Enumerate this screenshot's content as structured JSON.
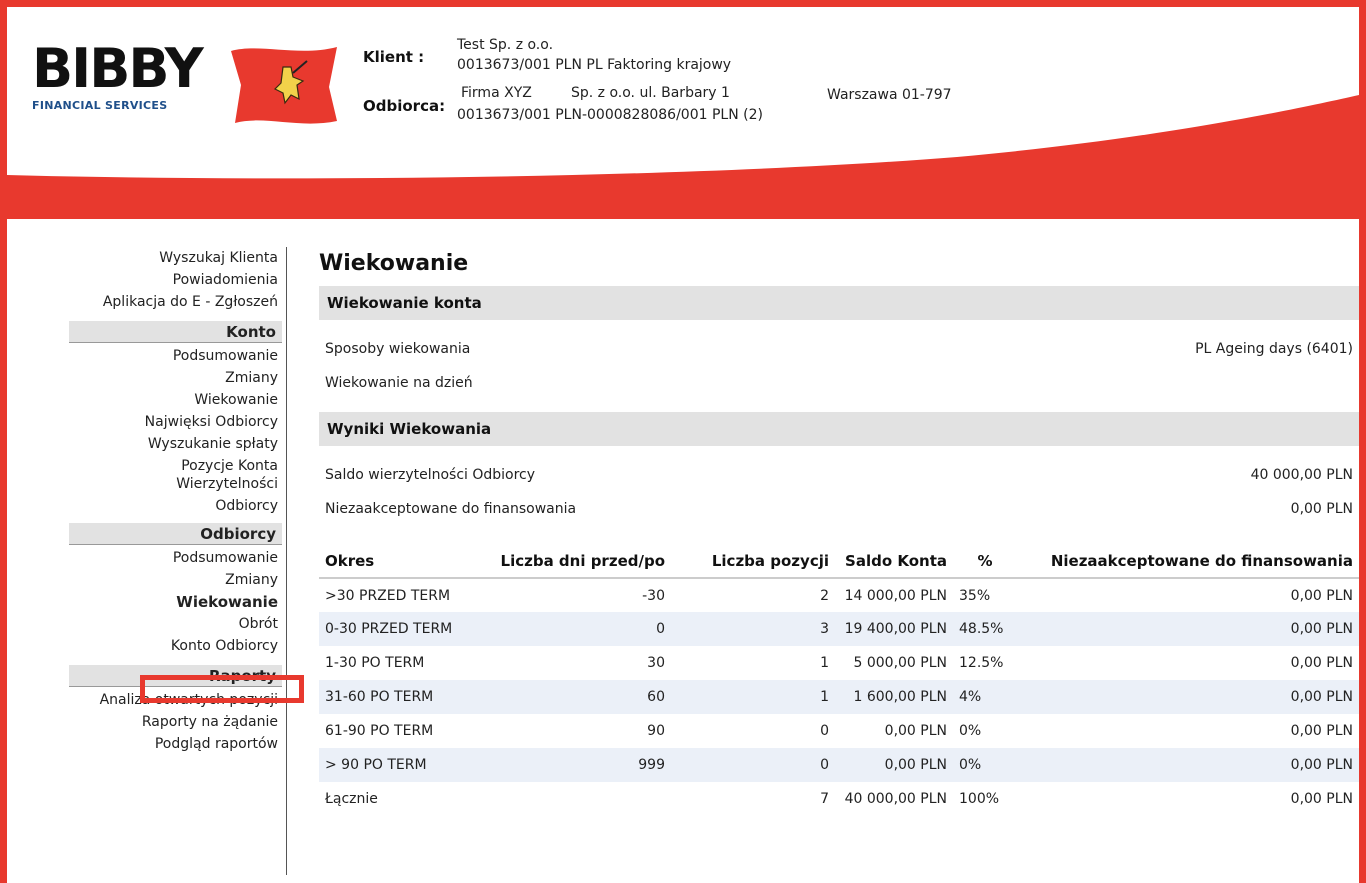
{
  "colors": {
    "brand_red": "#e8392e",
    "section_bar": "#e2e2e2",
    "row_alt": "#ebf0f8",
    "logo_blue": "#1f4f8a"
  },
  "header": {
    "logo_word": "BIBBY",
    "logo_sub": "FINANCIAL SERVICES",
    "flag_icon": "bibby-flag-icon",
    "client_label": "Klient :",
    "client_name": "Test Sp. z o.o.",
    "client_account": "0013673/001 PLN PL Faktoring krajowy",
    "debtor_label": "Odbiorca:",
    "debtor_name": "Firma XYZ",
    "debtor_address": "Sp. z o.o. ul. Barbary 1",
    "debtor_city": "Warszawa 01-797",
    "debtor_account": "0013673/001 PLN-0000828086/001 PLN (2)"
  },
  "sidebar": {
    "top_items": [
      "Wyszukaj Klienta",
      "Powiadomienia",
      "Aplikacja do E - Zgłoszeń"
    ],
    "konto": {
      "title": "Konto",
      "items": [
        "Podsumowanie",
        "Zmiany",
        "Wiekowanie",
        "Najwięksi Odbiorcy",
        "Wyszukanie spłaty"
      ],
      "multi_item": [
        "Pozycje Konta",
        "Wierzytelności",
        "Odbiorcy"
      ]
    },
    "odbiorcy": {
      "title": "Odbiorcy",
      "items": [
        "Podsumowanie",
        "Zmiany",
        "Wiekowanie",
        "Obrót",
        "Konto Odbiorcy"
      ]
    },
    "raporty": {
      "title": "Raporty",
      "items": [
        "Analiza otwartych pozycji",
        "Raporty na żądanie",
        "Podgląd raportów"
      ]
    }
  },
  "main": {
    "title": "Wiekowanie",
    "section1": "Wiekowanie konta",
    "aging_method_label": "Sposoby wiekowania",
    "aging_method_value": "PL Ageing days (6401)",
    "aging_date_label": "Wiekowanie na dzień",
    "section2": "Wyniki Wiekowania",
    "balance_label": "Saldo wierzytelności Odbiorcy",
    "balance_value": "40 000,00 PLN",
    "unaccepted_label": "Niezaakceptowane do finansowania",
    "unaccepted_value": "0,00 PLN",
    "table": {
      "headers": [
        "Okres",
        "Liczba dni przed/po",
        "Liczba pozycji",
        "Saldo Konta",
        "%",
        "Niezaakceptowane do finansowania"
      ],
      "rows": [
        [
          ">30 PRZED TERM",
          "-30",
          "2",
          "14 000,00 PLN",
          "35%",
          "0,00 PLN"
        ],
        [
          "0-30 PRZED TERM",
          "0",
          "3",
          "19 400,00 PLN",
          "48.5%",
          "0,00 PLN"
        ],
        [
          "1-30 PO TERM",
          "30",
          "1",
          "5 000,00 PLN",
          "12.5%",
          "0,00 PLN"
        ],
        [
          "31-60 PO TERM",
          "60",
          "1",
          "1 600,00 PLN",
          "4%",
          "0,00 PLN"
        ],
        [
          "61-90 PO TERM",
          "90",
          "0",
          "0,00 PLN",
          "0%",
          "0,00 PLN"
        ],
        [
          "> 90 PO TERM",
          "999",
          "0",
          "0,00 PLN",
          "0%",
          "0,00 PLN"
        ]
      ],
      "total": [
        "Łącznie",
        "",
        "7",
        "40 000,00 PLN",
        "100%",
        "0,00 PLN"
      ]
    }
  }
}
